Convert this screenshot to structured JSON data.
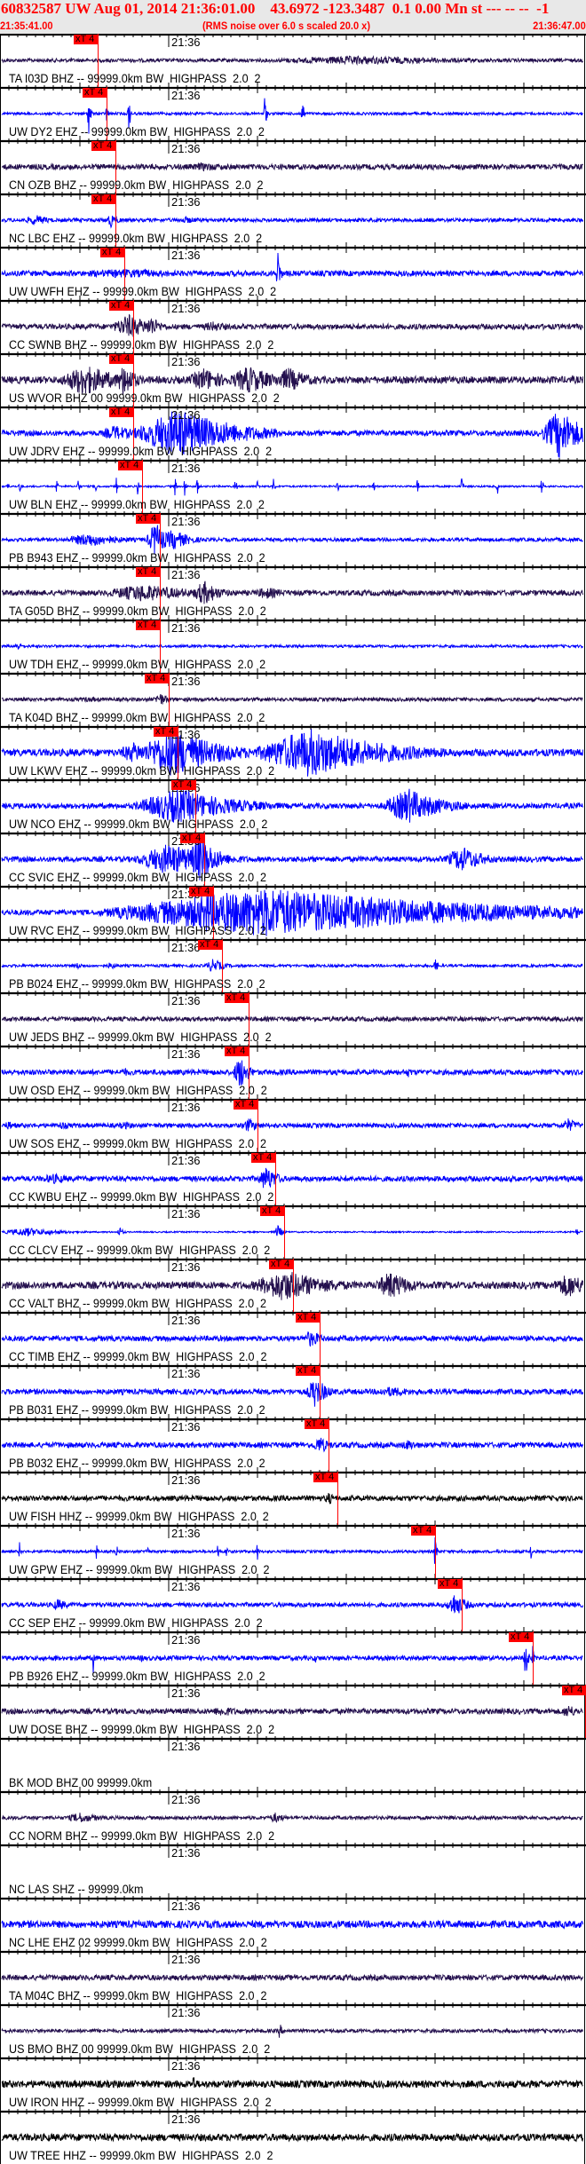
{
  "header": {
    "title": "60832587 UW Aug 01, 2014 21:36:01.00    43.6972 -123.3487  0.1 0.00 Mn st --- -- --  -1",
    "start_time": "21:35:41.00",
    "noise_note": "(RMS noise over 6.0 s scaled 20.0 x)",
    "end_time": "21:36:47.00"
  },
  "time_axis": {
    "start": "21:35:41.00",
    "end": "21:36:47.00",
    "minute_label": "21:36",
    "major_tick_seconds": 10,
    "minor_tick_seconds": 1
  },
  "pick_label": "xT 4",
  "colors": {
    "pick": "#ff0000",
    "bhz": "#24104e",
    "ehz": "#0000ff",
    "hhz": "#000000",
    "header_bg": "#e8e8e8"
  },
  "traces": [
    {
      "label": "TA I03D BHZ -- 99999.0km BW  HIGHPASS  2.0  2",
      "color": "#24104e",
      "pick": "21:35:52.0"
    },
    {
      "label": "UW DY2 EHZ -- 99999.0km BW  HIGHPASS  2.0  2",
      "color": "#0000ff",
      "pick": "21:35:53.0"
    },
    {
      "label": "CN OZB BHZ -- 99999.0km BW  HIGHPASS  2.0  2",
      "color": "#24104e",
      "pick": "21:35:54.0"
    },
    {
      "label": "NC LBC EHZ -- 99999.0km BW  HIGHPASS  2.0  2",
      "color": "#0000ff",
      "pick": "21:35:54.0"
    },
    {
      "label": "UW UWFH EHZ -- 99999.0km BW  HIGHPASS  2.0  2",
      "color": "#0000ff",
      "pick": "21:35:55.0"
    },
    {
      "label": "CC SWNB BHZ -- 99999.0km BW  HIGHPASS  2.0  2",
      "color": "#24104e",
      "pick": "21:35:56.0"
    },
    {
      "label": "US WVOR BHZ 00 99999.0km BW  HIGHPASS  2.0  2",
      "color": "#24104e",
      "pick": "21:35:56.0"
    },
    {
      "label": "UW JDRV EHZ -- 99999.0km BW  HIGHPASS  2.0  2",
      "color": "#0000ff",
      "pick": "21:35:56.0"
    },
    {
      "label": "UW BLN EHZ -- 99999.0km BW  HIGHPASS  2.0  2",
      "color": "#0000ff",
      "pick": "21:35:57.0"
    },
    {
      "label": "PB B943 EHZ -- 99999.0km BW  HIGHPASS  2.0  2",
      "color": "#0000ff",
      "pick": "21:35:59.0"
    },
    {
      "label": "TA G05D BHZ -- 99999.0km BW  HIGHPASS  2.0  2",
      "color": "#24104e",
      "pick": "21:35:59.0"
    },
    {
      "label": "UW TDH EHZ -- 99999.0km BW  HIGHPASS  2.0  2",
      "color": "#0000ff",
      "pick": "21:35:59.0"
    },
    {
      "label": "TA K04D BHZ -- 99999.0km BW  HIGHPASS  2.0  2",
      "color": "#24104e",
      "pick": "21:36:00.0"
    },
    {
      "label": "UW LKWV EHZ -- 99999.0km BW  HIGHPASS  2.0  2",
      "color": "#0000ff",
      "pick": "21:36:01.0"
    },
    {
      "label": "UW NCO EHZ -- 99999.0km BW  HIGHPASS  2.0  2",
      "color": "#0000ff",
      "pick": "21:36:03.0"
    },
    {
      "label": "CC SVIC EHZ -- 99999.0km BW  HIGHPASS  2.0  2",
      "color": "#0000ff",
      "pick": "21:36:04.0"
    },
    {
      "label": "UW RVC EHZ -- 99999.0km BW  HIGHPASS  2.0  2",
      "color": "#0000ff",
      "pick": "21:36:05.0"
    },
    {
      "label": "PB B024 EHZ -- 99999.0km BW  HIGHPASS  2.0  2",
      "color": "#0000ff",
      "pick": "21:36:06.0"
    },
    {
      "label": "UW JEDS BHZ -- 99999.0km BW  HIGHPASS  2.0  2",
      "color": "#24104e",
      "pick": "21:36:09.0"
    },
    {
      "label": "UW OSD EHZ -- 99999.0km BW  HIGHPASS  2.0  2",
      "color": "#0000ff",
      "pick": "21:36:09.0"
    },
    {
      "label": "UW SOS EHZ -- 99999.0km BW  HIGHPASS  2.0  2",
      "color": "#0000ff",
      "pick": "21:36:10.0"
    },
    {
      "label": "CC KWBU EHZ -- 99999.0km BW  HIGHPASS  2.0  2",
      "color": "#0000ff",
      "pick": "21:36:12.0"
    },
    {
      "label": "CC CLCV EHZ -- 99999.0km BW  HIGHPASS  2.0  2",
      "color": "#0000ff",
      "pick": "21:36:13.0"
    },
    {
      "label": "CC VALT BHZ -- 99999.0km BW  HIGHPASS  2.0  2",
      "color": "#24104e",
      "pick": "21:36:14.0"
    },
    {
      "label": "CC TIMB EHZ -- 99999.0km BW  HIGHPASS  2.0  2",
      "color": "#0000ff",
      "pick": "21:36:17.0"
    },
    {
      "label": "PB B031 EHZ -- 99999.0km BW  HIGHPASS  2.0  2",
      "color": "#0000ff",
      "pick": "21:36:17.0"
    },
    {
      "label": "PB B032 EHZ -- 99999.0km BW  HIGHPASS  2.0  2",
      "color": "#0000ff",
      "pick": "21:36:18.0"
    },
    {
      "label": "UW FISH HHZ -- 99999.0km BW  HIGHPASS  2.0  2",
      "color": "#000000",
      "pick": "21:36:19.0"
    },
    {
      "label": "UW GPW EHZ -- 99999.0km BW  HIGHPASS  2.0  2",
      "color": "#0000ff",
      "pick": "21:36:30.0"
    },
    {
      "label": "CC SEP EHZ -- 99999.0km BW  HIGHPASS  2.0  2",
      "color": "#0000ff",
      "pick": "21:36:33.0"
    },
    {
      "label": "PB B926 EHZ -- 99999.0km BW  HIGHPASS  2.0  2",
      "color": "#0000ff",
      "pick": "21:36:41.0"
    },
    {
      "label": "UW DOSE BHZ -- 99999.0km BW  HIGHPASS  2.0  2",
      "color": "#24104e",
      "pick": "21:36:47.0"
    },
    {
      "label": "BK MOD BHZ 00 99999.0km",
      "color": "#24104e",
      "pick": null
    },
    {
      "label": "CC NORM BHZ -- 99999.0km BW  HIGHPASS  2.0  2",
      "color": "#24104e",
      "pick": null
    },
    {
      "label": "NC LAS SHZ -- 99999.0km",
      "color": "#0000ff",
      "pick": null
    },
    {
      "label": "NC LHE EHZ 02 99999.0km BW  HIGHPASS  2.0  2",
      "color": "#0000ff",
      "pick": null
    },
    {
      "label": "TA M04C BHZ -- 99999.0km BW  HIGHPASS  2.0  2",
      "color": "#24104e",
      "pick": null
    },
    {
      "label": "US BMO BHZ 00 99999.0km BW  HIGHPASS  2.0  2",
      "color": "#24104e",
      "pick": null
    },
    {
      "label": "UW IRON HHZ -- 99999.0km BW  HIGHPASS  2.0  2",
      "color": "#000000",
      "pick": null
    },
    {
      "label": "UW TREE HHZ -- 99999.0km BW  HIGHPASS  2.0  2",
      "color": "#000000",
      "pick": null
    }
  ]
}
